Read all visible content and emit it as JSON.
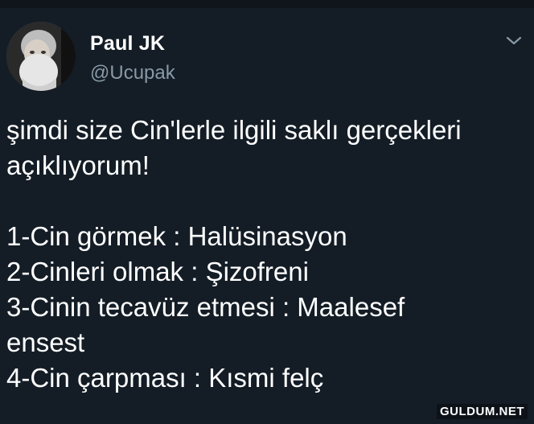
{
  "user": {
    "display_name": "Paul JK",
    "handle": "@Ucupak",
    "avatar": "bearded-man-photo"
  },
  "menu_icon": "chevron-down-icon",
  "tweet": {
    "lines": [
      "şimdi size Cin'lerle ilgili saklı gerçekleri",
      "açıklıyorum!",
      "",
      "1-Cin görmek : Halüsinasyon",
      "2-Cinleri olmak : Şizofreni",
      "3-Cinin tecavüz etmesi : Maalesef",
      "ensest",
      "4-Cin çarpması : Kısmi felç"
    ]
  },
  "watermark": "GULDUM.NET",
  "colors": {
    "background": "#141d26",
    "handle": "#8899a6",
    "text": "#ffffff"
  }
}
